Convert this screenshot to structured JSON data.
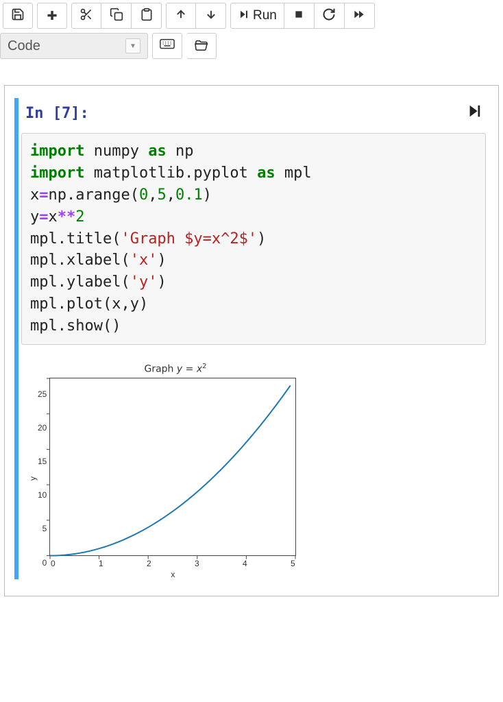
{
  "toolbar": {
    "save": "💾",
    "add": "✚",
    "cut": "✂",
    "copy": "⧉",
    "paste": "📋",
    "up": "↑",
    "down": "↓",
    "run_glyph": "▶▎",
    "run_label": "Run",
    "stop": "■",
    "restart": "↻",
    "forward": "⏩"
  },
  "celltype": {
    "selected": "Code",
    "caret": "▼"
  },
  "cell": {
    "prompt": "In [7]:",
    "run_icon": "▶▎",
    "code": {
      "l1_kw1": "import",
      "l1_t1": " numpy ",
      "l1_kw2": "as",
      "l1_t2": " np",
      "l2_kw1": "import",
      "l2_t1": " matplotlib.pyplot ",
      "l2_kw2": "as",
      "l2_t2": " mpl",
      "l3_a": "x",
      "l3_eq": "=",
      "l3_b": "np.arange(",
      "l3_n1": "0",
      "l3_c1": ",",
      "l3_n2": "5",
      "l3_c2": ",",
      "l3_n3": "0.1",
      "l3_d": ")",
      "l4_a": "y",
      "l4_eq": "=",
      "l4_b": "x",
      "l4_op": "**",
      "l4_n": "2",
      "l5_a": "mpl.title(",
      "l5_s": "'Graph $y=x^2$'",
      "l5_b": ")",
      "l6_a": "mpl.xlabel(",
      "l6_s": "'x'",
      "l6_b": ")",
      "l7_a": "mpl.ylabel(",
      "l7_s": "'y'",
      "l7_b": ")",
      "l8": "mpl.plot(x,y)",
      "l9": "mpl.show()"
    }
  },
  "chart_data": {
    "type": "line",
    "title": "Graph y = x²",
    "xlabel": "x",
    "ylabel": "y",
    "xlim": [
      0,
      5
    ],
    "ylim": [
      0,
      25
    ],
    "xticks": [
      0,
      1,
      2,
      3,
      4,
      5
    ],
    "yticks": [
      0,
      5,
      10,
      15,
      20,
      25
    ],
    "x": [
      0,
      0.1,
      0.2,
      0.3,
      0.4,
      0.5,
      0.6,
      0.7,
      0.8,
      0.9,
      1.0,
      1.1,
      1.2,
      1.3,
      1.4,
      1.5,
      1.6,
      1.7,
      1.8,
      1.9,
      2.0,
      2.1,
      2.2,
      2.3,
      2.4,
      2.5,
      2.6,
      2.7,
      2.8,
      2.9,
      3.0,
      3.1,
      3.2,
      3.3,
      3.4,
      3.5,
      3.6,
      3.7,
      3.8,
      3.9,
      4.0,
      4.1,
      4.2,
      4.3,
      4.4,
      4.5,
      4.6,
      4.7,
      4.8,
      4.9
    ],
    "y": [
      0,
      0.01,
      0.04,
      0.09,
      0.16,
      0.25,
      0.36,
      0.49,
      0.64,
      0.81,
      1.0,
      1.21,
      1.44,
      1.69,
      1.96,
      2.25,
      2.56,
      2.89,
      3.24,
      3.61,
      4.0,
      4.41,
      4.84,
      5.29,
      5.76,
      6.25,
      6.76,
      7.29,
      7.84,
      8.41,
      9.0,
      9.61,
      10.24,
      10.89,
      11.56,
      12.25,
      12.96,
      13.69,
      14.44,
      15.21,
      16.0,
      16.81,
      17.64,
      18.49,
      19.36,
      20.25,
      21.16,
      22.09,
      23.04,
      24.01
    ],
    "line_color": "#1f77b4"
  }
}
